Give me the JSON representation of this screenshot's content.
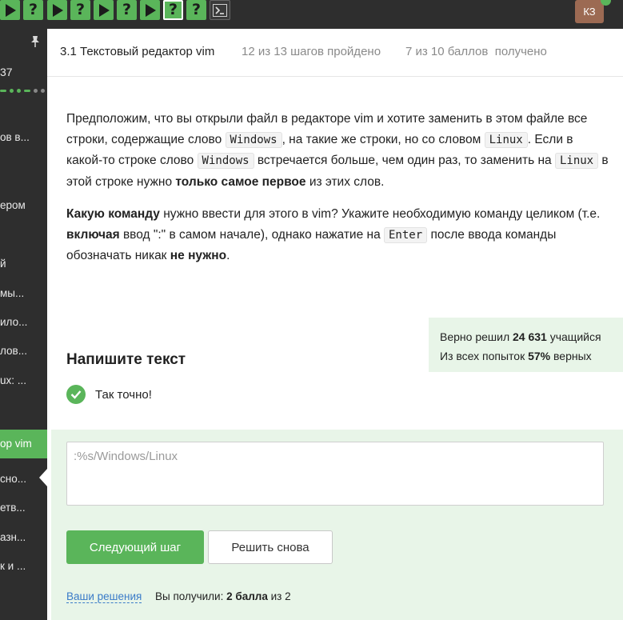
{
  "topbar": {
    "steps": [
      "play",
      "question",
      "play",
      "question",
      "play",
      "question",
      "play",
      "question",
      "question"
    ],
    "active_step": 7,
    "avatar_initials": "КЗ",
    "colors": {
      "bar": "#2e2e2e",
      "step": "#5ab55a"
    }
  },
  "sidebar": {
    "counter": "37",
    "items": [
      {
        "label": "ов в..."
      },
      {
        "label": "ером"
      },
      {
        "label": "й"
      },
      {
        "label": "мы..."
      },
      {
        "label": "ило..."
      },
      {
        "label": "лов..."
      },
      {
        "label": "ux: ..."
      },
      {
        "label": "ор vim"
      },
      {
        "label": "сно..."
      },
      {
        "label": "етв..."
      },
      {
        "label": "азн..."
      },
      {
        "label": "к и ..."
      }
    ]
  },
  "header": {
    "title": "3.1 Текстовый редактор vim",
    "steps_progress": "12 из 13 шагов пройдено",
    "score": "7 из 10 баллов  получено"
  },
  "question": {
    "p1": {
      "t1": "Предположим, что вы открыли файл в редакторе vim и хотите заменить в этом файле все строки, содержащие слово ",
      "c1": "Windows",
      "t2": ", на такие же строки, но со словом ",
      "c2": "Linux",
      "t3": ". Если в какой-то строке слово ",
      "c3": "Windows",
      "t4": " встречается больше, чем один раз, то заменить на ",
      "c4": "Linux",
      "t5": " в этой строке нужно ",
      "b1": "только самое первое",
      "t6": " из этих слов."
    },
    "p2": {
      "b1": "Какую команду",
      "t1": " нужно ввести для этого в vim? Укажите необходимую команду целиком (т.е. ",
      "b2": "включая",
      "t2": " ввод \":\" в самом начале), однако нажатие на ",
      "c1": "Enter",
      "t3": " после ввода команды обозначать никак ",
      "b3": "не нужно",
      "t4": "."
    }
  },
  "stats": {
    "solved_prefix": "Верно решил ",
    "solved_count": "24 631",
    "solved_suffix": " учащийся",
    "attempts_prefix": "Из всех попыток ",
    "attempts_percent": "57%",
    "attempts_suffix": " верных"
  },
  "answer": {
    "section_title": "Напишите текст",
    "status": "Так точно!",
    "text": ":%s/Windows/Linux",
    "next_button": "Следующий шаг",
    "retry_button": "Решить снова",
    "solutions_link": "Ваши решения",
    "result_prefix": "Вы получили: ",
    "result_points": "2 балла",
    "result_suffix": " из 2"
  }
}
